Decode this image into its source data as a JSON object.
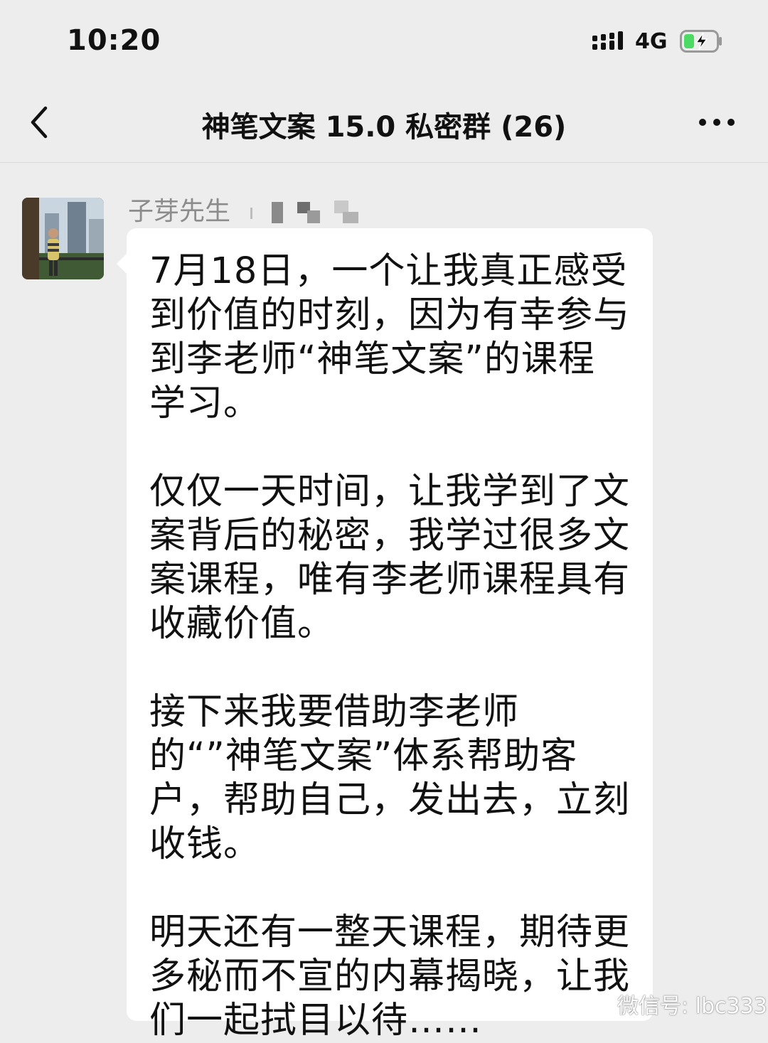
{
  "status_bar": {
    "time": "10:20",
    "network": "4G"
  },
  "nav": {
    "title": "神笔文案 15.0 私密群 (26)"
  },
  "message": {
    "sender": "子芽先生",
    "paragraphs": [
      "7月18日，一个让我真正感受到价值的时刻，因为有幸参与到李老师“神笔文案”的课程学习。",
      "仅仅一天时间，让我学到了文案背后的秘密，我学过很多文案课程，唯有李老师课程具有收藏价值。",
      "接下来我要借助李老师的“”神笔文案”体系帮助客户，帮助自己，发出去，立刻收钱。",
      "明天还有一整天课程，期待更多秘而不宣的内幕揭晓，让我们一起拭目以待……"
    ]
  },
  "watermark": {
    "text": "微信号: lbc333"
  },
  "colors": {
    "background": "#ededed",
    "bubble": "#ffffff",
    "battery_charge": "#4cd964",
    "sender_text": "#8c8c8c"
  }
}
